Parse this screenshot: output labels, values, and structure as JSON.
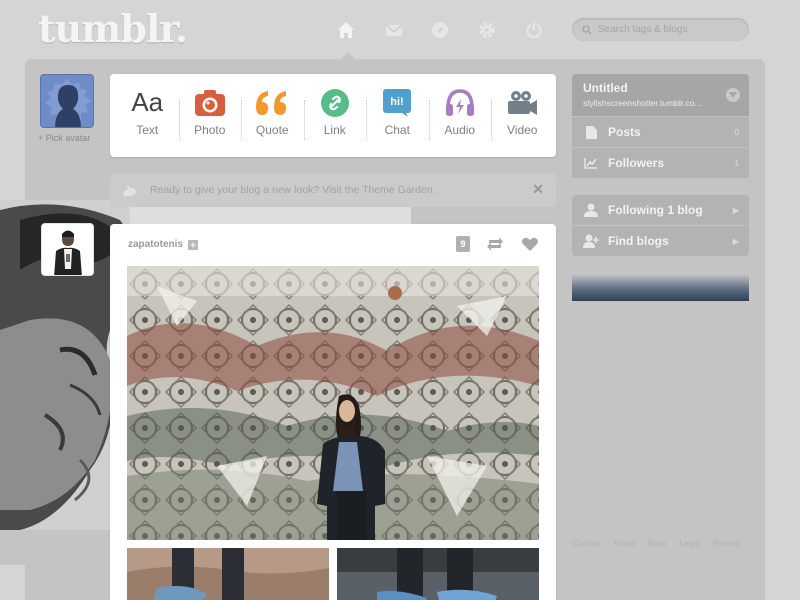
{
  "app": {
    "logo": "tumblr."
  },
  "nav": {
    "items": [
      {
        "name": "home",
        "icon": "home-icon"
      },
      {
        "name": "messages",
        "icon": "envelope-icon"
      },
      {
        "name": "activity",
        "icon": "compass-icon"
      },
      {
        "name": "settings",
        "icon": "gear-icon"
      },
      {
        "name": "logout",
        "icon": "power-icon"
      }
    ],
    "active": "home"
  },
  "search": {
    "placeholder": "Search tags & blogs"
  },
  "avatar": {
    "pick_label": "+ Pick avatar"
  },
  "composer": {
    "types": [
      {
        "label": "Text",
        "icon": "text-icon",
        "glyph": "Aa"
      },
      {
        "label": "Photo",
        "icon": "camera-icon",
        "color": "#d95e40"
      },
      {
        "label": "Quote",
        "icon": "quote-icon",
        "color": "#f2992e"
      },
      {
        "label": "Link",
        "icon": "link-icon",
        "color": "#56bc8a"
      },
      {
        "label": "Chat",
        "icon": "chat-icon",
        "glyph": "hi!",
        "color": "#529ecc"
      },
      {
        "label": "Audio",
        "icon": "headphones-icon",
        "color": "#a77dc2"
      },
      {
        "label": "Video",
        "icon": "video-camera-icon",
        "color": "#748089"
      }
    ]
  },
  "banner": {
    "text": "Ready to give your blog a new look? Visit the Theme Garden.",
    "close": "✕"
  },
  "post": {
    "author": "zapatotenis",
    "follow_glyph": "+",
    "note_count": "9"
  },
  "sidebar": {
    "blog_title": "Untitled",
    "blog_url": "stylishscreenshotter.tumblr.co...",
    "posts_label": "Posts",
    "posts_count": "0",
    "followers_label": "Followers",
    "followers_count": "1",
    "following_label": "Following 1 blog",
    "find_label": "Find blogs",
    "arrow": "▶"
  },
  "footer": {
    "links": [
      "Contact",
      "About",
      "Apps",
      "Legal",
      "Privacy"
    ]
  },
  "colors": {
    "page_bg": "#d5d5d5",
    "panel_bg": "#c4c4c4",
    "avatar_blue": "#6f8cc9"
  }
}
